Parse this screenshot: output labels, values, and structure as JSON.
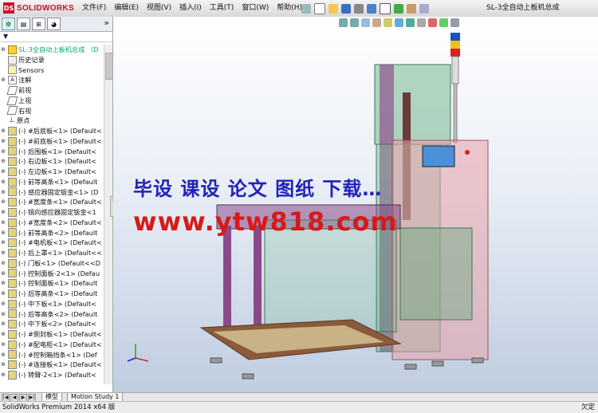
{
  "app": {
    "logo_text": "SOLIDWORKS",
    "document_title": "SL-3全自动上板机总成"
  },
  "menu": [
    "文件(F)",
    "编辑(E)",
    "视图(V)",
    "插入(I)",
    "工具(T)",
    "窗口(W)",
    "帮助(H)"
  ],
  "panel": {
    "tabs": [
      "feature-manager",
      "property-manager",
      "configuration-manager",
      "display-manager"
    ],
    "filter_label": "▼",
    "tree": [
      {
        "label": "SL-3全自动上板机总成 （D",
        "type": "asm",
        "top": true
      },
      {
        "label": "历史记录",
        "type": "hist"
      },
      {
        "label": "Sensors",
        "type": "sens"
      },
      {
        "label": "注解",
        "type": "note",
        "expandable": true
      },
      {
        "label": "前视",
        "type": "plane"
      },
      {
        "label": "上视",
        "type": "plane"
      },
      {
        "label": "右视",
        "type": "plane"
      },
      {
        "label": "原点",
        "type": "origin"
      },
      {
        "label": "(-) #后底板<1> (Default<",
        "type": "part",
        "expandable": true
      },
      {
        "label": "(-) #前底板<1> (Default<",
        "type": "part",
        "expandable": true
      },
      {
        "label": "(-) 后围板<1> (Default<",
        "type": "part",
        "expandable": true
      },
      {
        "label": "(-) 右边板<1> (Default<",
        "type": "part",
        "expandable": true
      },
      {
        "label": "(-) 左边板<1> (Default<",
        "type": "part",
        "expandable": true
      },
      {
        "label": "(-) 前等高条<1> (Default",
        "type": "part",
        "expandable": true
      },
      {
        "label": "(-) 感应器固定钣金<1> (D",
        "type": "part",
        "expandable": true
      },
      {
        "label": "(-) #宽度条<1> (Default<",
        "type": "part",
        "expandable": true
      },
      {
        "label": "(-) 镜向感应器固定钣金<1",
        "type": "part",
        "expandable": true
      },
      {
        "label": "(-) #宽度条<2> (Default<",
        "type": "part",
        "expandable": true
      },
      {
        "label": "(-) 前等高条<2> (Default",
        "type": "part",
        "expandable": true
      },
      {
        "label": "(-) #电机板<1> (Default<",
        "type": "part",
        "expandable": true
      },
      {
        "label": "(-) 后上罩<1> (Default<<",
        "type": "part",
        "expandable": true
      },
      {
        "label": "(-) 门板<1> (Default<<D",
        "type": "part",
        "expandable": true
      },
      {
        "label": "(-) 控制面板-2<1> (Defau",
        "type": "part",
        "expandable": true
      },
      {
        "label": "(-) 控制面板<1> (Default",
        "type": "part",
        "expandable": true
      },
      {
        "label": "(-) 后等高条<1> (Default",
        "type": "part",
        "expandable": true
      },
      {
        "label": "(-) 中下板<1> (Default<",
        "type": "part",
        "expandable": true
      },
      {
        "label": "(-) 后等高条<2> (Default",
        "type": "part",
        "expandable": true
      },
      {
        "label": "(-) 中下板<2> (Default<",
        "type": "part",
        "expandable": true
      },
      {
        "label": "(-) #侧封板<1> (Default<",
        "type": "part",
        "expandable": true
      },
      {
        "label": "(-) #配电柜<1> (Default<",
        "type": "part",
        "expandable": true
      },
      {
        "label": "(-) #控制箱挡条<1> (Def",
        "type": "part",
        "expandable": true
      },
      {
        "label": "(-) #连接板<1> (Default<",
        "type": "part",
        "expandable": true
      },
      {
        "label": "(-) 转臂-2<1> (Default<",
        "type": "part",
        "expandable": true
      }
    ]
  },
  "bottom_tabs": [
    "模型",
    "Motion Study 1"
  ],
  "status": {
    "left": "SolidWorks Premium 2014 x64 版",
    "right": "欠定"
  },
  "watermark": {
    "line1": "毕设 课设 论文 图纸 下载…",
    "line2": "www.ytw818.com"
  },
  "colors": {
    "frame_purple": "#8a4a8a",
    "glass_green": "#5aa878",
    "cabinet_pink": "#e8a3a8",
    "base_brown": "#8a5a3a",
    "screen_blue": "#4a8fd8",
    "tower_red": "#d82020",
    "tower_yellow": "#f0c020",
    "tower_blue": "#2050c0"
  }
}
